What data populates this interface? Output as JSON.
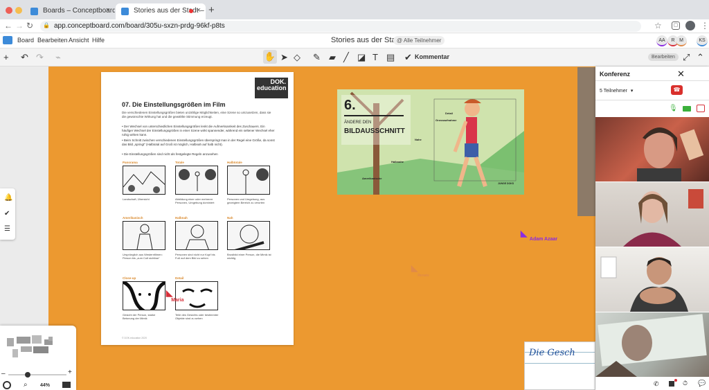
{
  "browser": {
    "tabs": [
      {
        "label": "Boards – Conceptboard"
      },
      {
        "label": "Stories aus der Stadt – Co"
      }
    ],
    "new_tab": "+",
    "url": "app.conceptboard.com/board/305u-sxzn-prdg-96kf-p8ts"
  },
  "app": {
    "menu": [
      "Board",
      "Bearbeiten",
      "Ansicht",
      "Hilfe"
    ],
    "board_title": "Stories aus der Stadt",
    "all_participants": "@ Alle Teilnehmer",
    "avatars": [
      "AA",
      "R",
      "M",
      "KS"
    ],
    "comment_label": "Kommentar",
    "edit_mode": "Bearbeiten"
  },
  "document": {
    "logo_line1": "DOK.",
    "logo_line2": "education",
    "title": "07. Die Einstellungsgrößen im Film",
    "intro": "Die verschiedenen Einstellungsgrößen bieten unzählige Möglichkeiten, eine Szene so umzusetzen, dass sie die gewünschte Wirkung hat und die gewählte Stimmung erzeugt.",
    "bullets": [
      "• Der Wechsel von unterschiedlichen Einstellungsgrößen lenkt die Aufmerksamkeit des Zuschauers. Ein häufiger Wechsel der Einstellungsgrößen in einer Szene wirkt spannender, während ein seltener Wechsel eher ruhig wirken kann.",
      "• Beim Schnitt zwischen verschiedenen Einstellungsgrößen überspringt man in der Regel eine Größe, da sonst das Bild „springt“ (Halbtotal auf Groß ist möglich, Halbnah auf halb nicht).",
      "• Die Einstellungsgrößen sind nicht als festgelegte Regeln anzusehen"
    ],
    "cells": [
      {
        "label": "Panorama",
        "caption": "Landschaft, Übersicht"
      },
      {
        "label": "Totale",
        "caption": "Abbildung einer oder mehrerer Personen, Umgebung dominiert"
      },
      {
        "label": "Halbtotale",
        "caption": "Personen und Umgebung, aus gezeigtem Bereich zu verorten"
      },
      {
        "label": "Amerikanisch",
        "caption": "Ursprünglich aus Westernfilmen: Person bis „zum Colt sichtbar“"
      },
      {
        "label": "Halbnah",
        "caption": "Personen sind nicht nur Kopf bis Fuß auf dem Bild zu sehen"
      },
      {
        "label": "Nah",
        "caption": "Brustbild einer Person, die Mimik ist wichtig"
      },
      {
        "label": "Close-up",
        "caption": "Gesicht der Person, starke Betonung der Mimik"
      },
      {
        "label": "Detail",
        "caption": "Teile des Gesichts oder bestimmter Objekte sind zu sehen"
      }
    ],
    "footer": "© DOK.education 2020"
  },
  "slide": {
    "number": "6.",
    "subtitle": "ÄNDERE DEN",
    "title": "BILDAUSSCHNITT",
    "labels": [
      "Detail",
      "Grossaufnahme",
      "Nahe",
      "Halbnahe",
      "Amerikanische"
    ],
    "brand": "JUNGE DOKS"
  },
  "cursors": [
    {
      "name": "Adam Azaar",
      "color": "#8a2be2"
    },
    {
      "name": "Maria",
      "color": "#d6303a"
    },
    {
      "name": "Renate",
      "color": "#e08a48"
    }
  ],
  "handwriting": "Die Gesch",
  "minimap": {
    "zoom": "44%"
  },
  "conference": {
    "title": "Konferenz",
    "participants": "5 Teilnehmer"
  }
}
